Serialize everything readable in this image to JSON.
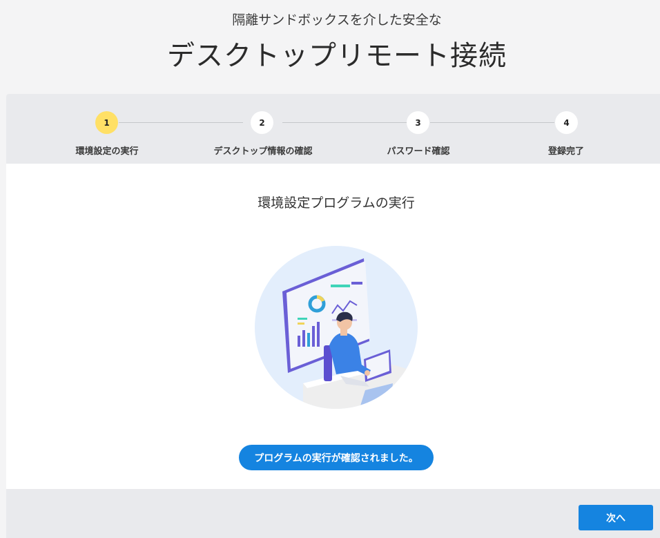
{
  "header": {
    "subtitle": "隔離サンドボックスを介した安全な",
    "title": "デスクトップリモート接続"
  },
  "stepper": {
    "current_step": 1,
    "steps": [
      {
        "number": "1",
        "label": "環境設定の実行"
      },
      {
        "number": "2",
        "label": "デスクトップ情報の確認"
      },
      {
        "number": "3",
        "label": "パスワード確認"
      },
      {
        "number": "4",
        "label": "登録完了"
      }
    ]
  },
  "main": {
    "heading": "環境設定プログラムの実行",
    "status_message": "プログラムの実行が確認されました。"
  },
  "footer": {
    "next_label": "次へ"
  },
  "colors": {
    "accent": "#1584e0",
    "active_step": "#ffe066"
  },
  "icons": {
    "illustration": "person-at-desk-with-dashboard-illustration"
  }
}
